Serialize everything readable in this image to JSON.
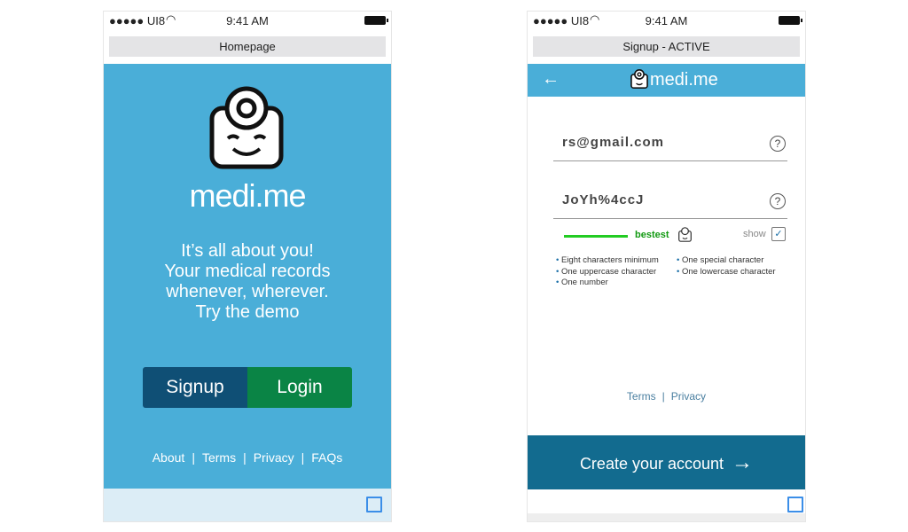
{
  "status_bar": {
    "carrier": "●●●●● UI8",
    "time": "9:41 AM"
  },
  "homepage": {
    "title": "Homepage",
    "brand": "medi.me",
    "tagline": [
      "It’s all about you!",
      "Your medical records",
      "whenever, wherever.",
      "Try the demo"
    ],
    "signup_label": "Signup",
    "login_label": "Login",
    "footer_links": [
      "About",
      "Terms",
      "Privacy",
      "FAQs"
    ],
    "colors": {
      "hero": "#4aaed8",
      "signup": "#0f4f75",
      "login": "#0a8445"
    }
  },
  "signup": {
    "title": "Signup - ACTIVE",
    "brand": "medi.me",
    "email_value": "rs@gmail.com",
    "password_value": "JoYh%4ccJ",
    "help_glyph": "?",
    "strength_label": "bestest",
    "strength_level": 1.0,
    "show_label": "show",
    "show_checked": true,
    "requirements": [
      "Eight characters minimum",
      "One special character",
      "One uppercase character",
      "One lowercase character",
      "One number"
    ],
    "footer_links": [
      "Terms",
      "Privacy"
    ],
    "cta_label": "Create your account",
    "colors": {
      "cta": "#126b8f",
      "strength": "#22cc22"
    }
  }
}
